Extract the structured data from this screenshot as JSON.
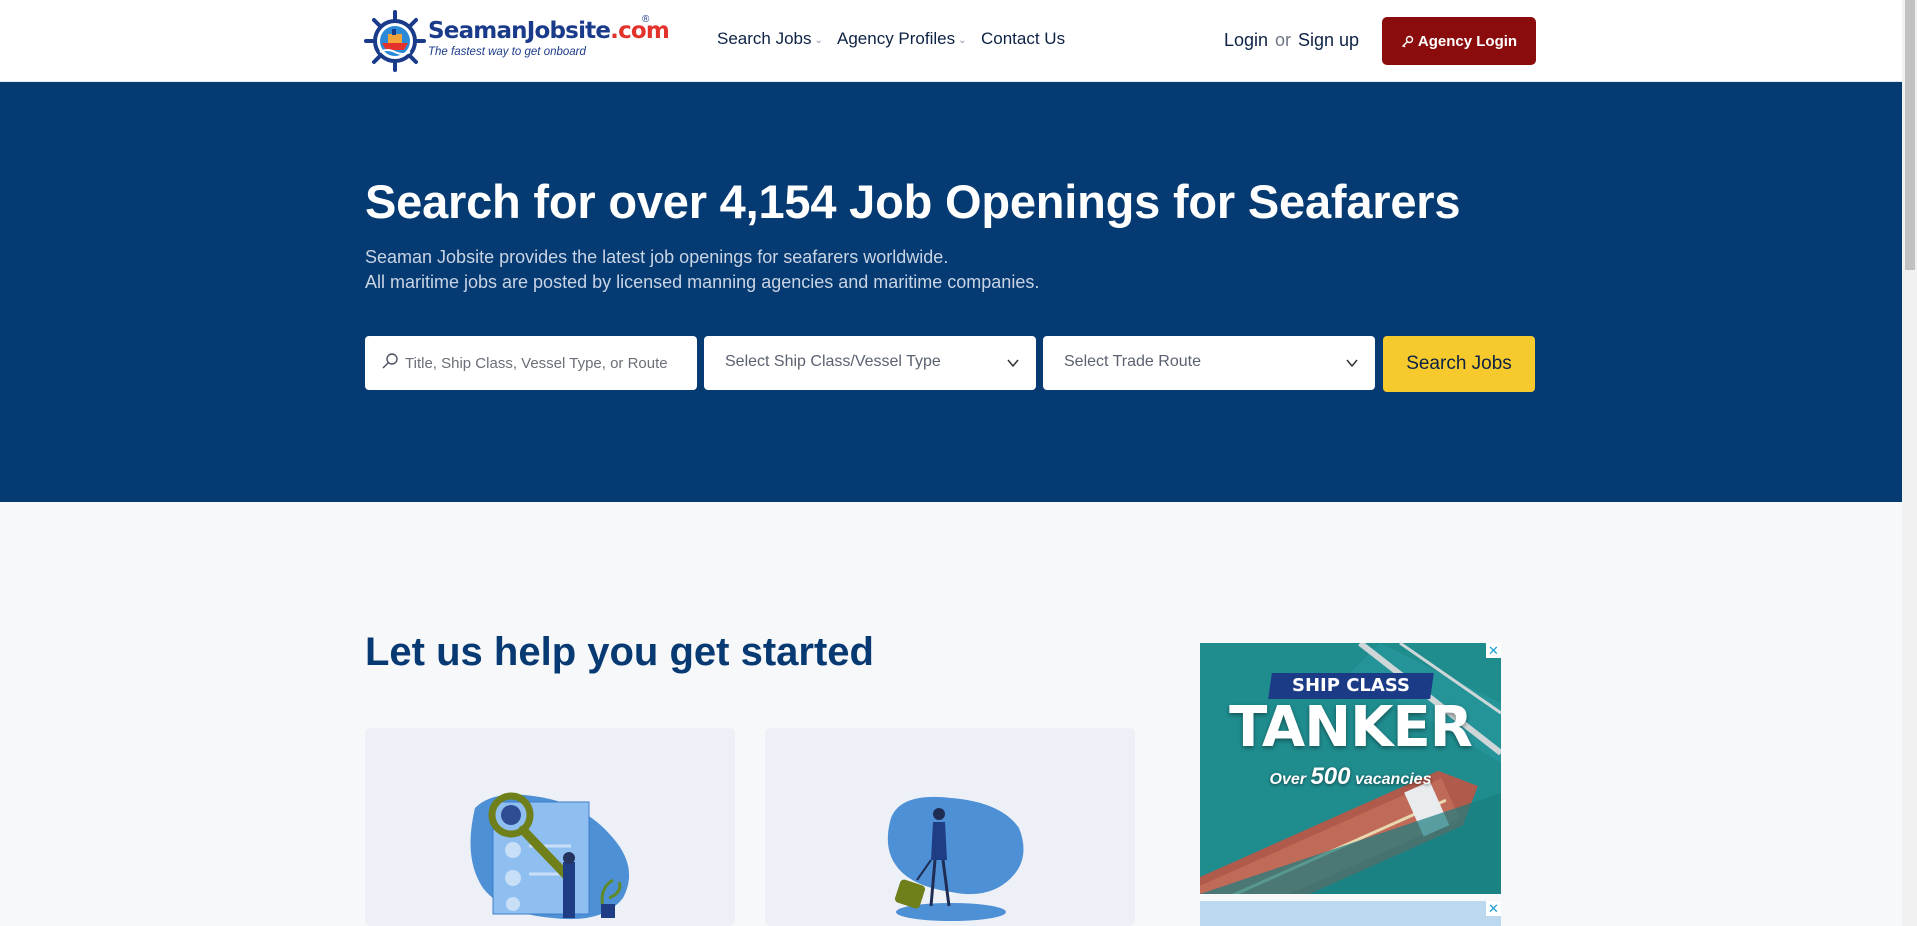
{
  "header": {
    "logo": {
      "name_main": "Seaman",
      "name_accent": "Jobsite",
      "name_suffix": ".com",
      "registered": "®",
      "tagline": "The fastest way to get onboard"
    },
    "nav": [
      {
        "label": "Search Jobs",
        "has_dropdown": true
      },
      {
        "label": "Agency Profiles",
        "has_dropdown": true
      },
      {
        "label": "Contact Us",
        "has_dropdown": false
      }
    ],
    "login_label": "Login",
    "or_label": "or",
    "signup_label": "Sign up",
    "agency_login_label": "Agency Login"
  },
  "hero": {
    "title": "Search for over 4,154 Job Openings for Seafarers",
    "subtitle_line1": "Seaman Jobsite provides the latest job openings for seafarers worldwide.",
    "subtitle_line2": "All maritime jobs are posted by licensed manning agencies and maritime companies.",
    "search_placeholder": "Title, Ship Class, Vessel Type, or Route",
    "ship_class_select": "Select Ship Class/Vessel Type",
    "trade_route_select": "Select Trade Route",
    "search_button": "Search Jobs"
  },
  "main": {
    "section_title": "Let us help you get started"
  },
  "ad": {
    "ribbon": "SHIP CLASS",
    "headline": "TANKER",
    "sub_prefix": "Over",
    "sub_number": "500",
    "sub_suffix": "vacancies",
    "close": "✕"
  },
  "colors": {
    "hero_bg": "#053a72",
    "agency_button": "#8b0c0c",
    "search_button": "#f6c92c",
    "heading": "#073a72"
  },
  "icons": [
    "ship-wheel-icon",
    "search-icon",
    "chevron-down-icon",
    "key-icon",
    "close-icon"
  ]
}
